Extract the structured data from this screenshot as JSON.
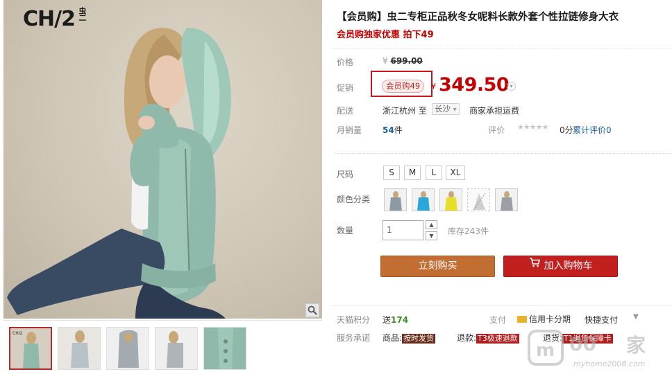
{
  "gallery": {
    "brand_logo": "CH/2",
    "brand_logo_small": "虫二",
    "zoom_icon": "magnifier-icon",
    "thumbnails": [
      "thumb-1",
      "thumb-2",
      "thumb-3",
      "thumb-4",
      "thumb-5"
    ]
  },
  "product": {
    "title": "【会员购】虫二专柜正品秋冬女呢料长款外套个性拉链修身大衣",
    "subtitle": "会员购独家优惠 拍下49"
  },
  "price": {
    "label": "价格",
    "currency": "¥",
    "original": "699.00",
    "promo_label": "促销",
    "promo_tag": "会员购49",
    "promo_price": "349.50",
    "toggle_icon": "chevron-down-icon"
  },
  "shipping": {
    "label": "配送",
    "from": "浙江杭州 至",
    "to": "长沙",
    "to_arrow": "▾",
    "fee": "商家承担运费"
  },
  "sales": {
    "label": "月销量",
    "count": "54",
    "unit": "件",
    "rating_label": "评价",
    "stars": "★★★★★",
    "score": "0分",
    "reviews_link": "累计评价0"
  },
  "sizes": {
    "label": "尺码",
    "options": [
      "S",
      "M",
      "L",
      "XL"
    ]
  },
  "colors": {
    "label": "颜色分类",
    "swatches": [
      "#8d9aa6",
      "#2aa6d8",
      "#e6e02a",
      "#d0d0d0",
      "#9aa0a6"
    ]
  },
  "quantity": {
    "label": "数量",
    "value": "1",
    "up": "▲",
    "down": "▼",
    "stock": "库存243件"
  },
  "actions": {
    "buy_now": "立刻购买",
    "add_to_cart": "加入购物车"
  },
  "rewards": {
    "points_label": "天猫积分",
    "points_prefix": "送",
    "points_value": "174",
    "pay_label": "支付",
    "credit": "信用卡分期",
    "quick_pay": "快捷支付",
    "more": "▼"
  },
  "services": {
    "label": "服务承诺",
    "items": [
      {
        "prefix": "商品:",
        "badge": "按时发货"
      },
      {
        "prefix": "退款:",
        "badge": "T3极速退款"
      },
      {
        "prefix": "退货:",
        "badge": "T1退货保障卡"
      }
    ]
  },
  "watermark": {
    "text": "家",
    "url": "myhome2008.com"
  },
  "colors_theme": {
    "accent_red": "#c40000",
    "buy_orange": "#c26d32",
    "cart_red": "#c21f1f",
    "link_blue": "#1a5f9e"
  }
}
